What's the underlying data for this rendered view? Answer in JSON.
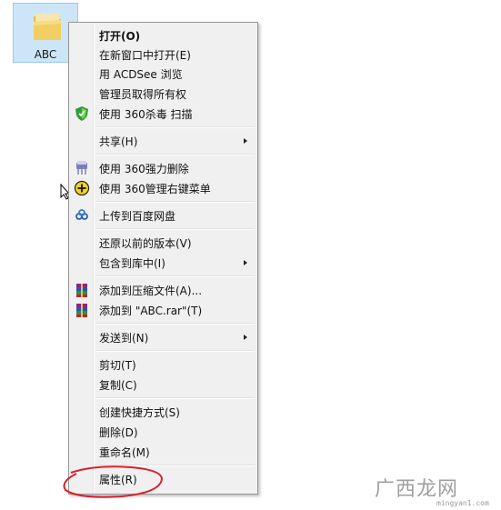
{
  "desktop": {
    "folder": {
      "label": "ABC",
      "icon": "folder-icon"
    }
  },
  "context_menu": {
    "items": [
      {
        "label": "打开(O)",
        "bold": true
      },
      {
        "label": "在新窗口中打开(E)"
      },
      {
        "label": "用 ACDSee 浏览"
      },
      {
        "label": "管理员取得所有权"
      },
      {
        "label": "使用 360杀毒 扫描",
        "icon": "shield-icon"
      },
      {
        "label": "共享(H)",
        "submenu": true
      },
      {
        "label": "使用 360强力删除",
        "icon": "shredder-icon"
      },
      {
        "label": "使用 360管理右键菜单",
        "icon": "plus-circle-icon"
      },
      {
        "label": "上传到百度网盘",
        "icon": "baidu-cloud-icon"
      },
      {
        "label": "还原以前的版本(V)"
      },
      {
        "label": "包含到库中(I)",
        "submenu": true
      },
      {
        "label": "添加到压缩文件(A)...",
        "icon": "winrar-icon"
      },
      {
        "label": "添加到 \"ABC.rar\"(T)",
        "icon": "winrar-icon"
      },
      {
        "label": "发送到(N)",
        "submenu": true
      },
      {
        "label": "剪切(T)"
      },
      {
        "label": "复制(C)"
      },
      {
        "label": "创建快捷方式(S)"
      },
      {
        "label": "删除(D)"
      },
      {
        "label": "重命名(M)"
      },
      {
        "label": "属性(R)"
      }
    ]
  },
  "annotation": {
    "color": "#d9202a"
  },
  "watermark": {
    "text": "广西龙网",
    "url": "mingyan1.com"
  }
}
